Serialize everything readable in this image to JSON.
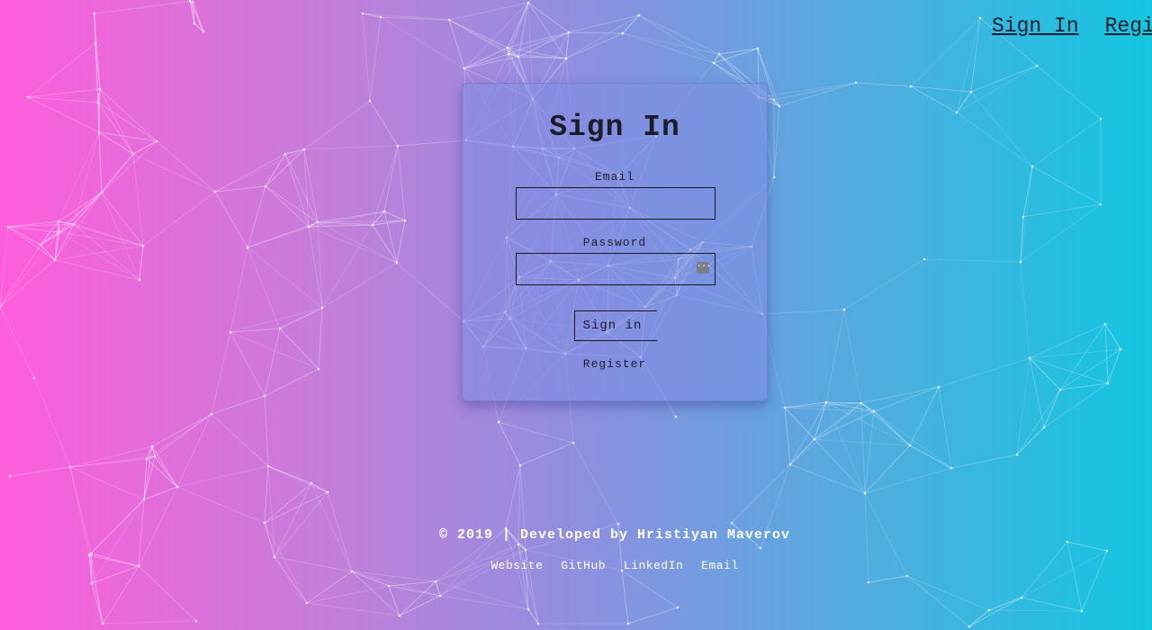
{
  "nav": {
    "sign_in": "Sign In",
    "register": "Register"
  },
  "login": {
    "title": "Sign In",
    "email_label": "Email",
    "email_value": "",
    "password_label": "Password",
    "password_value": "",
    "password_manager_icon": "password-manager-icon",
    "submit_label": "Sign in",
    "register_link": "Register"
  },
  "footer": {
    "copyright": "© 2019 | Developed by Hristiyan Maverov",
    "links": [
      "Website",
      "GitHub",
      "LinkedIn",
      "Email"
    ]
  },
  "colors": {
    "gradient_left": "#ff5ddc",
    "gradient_right": "#13c6e0",
    "text_dark": "#1d1d2a",
    "footer_text": "#ffffff"
  }
}
